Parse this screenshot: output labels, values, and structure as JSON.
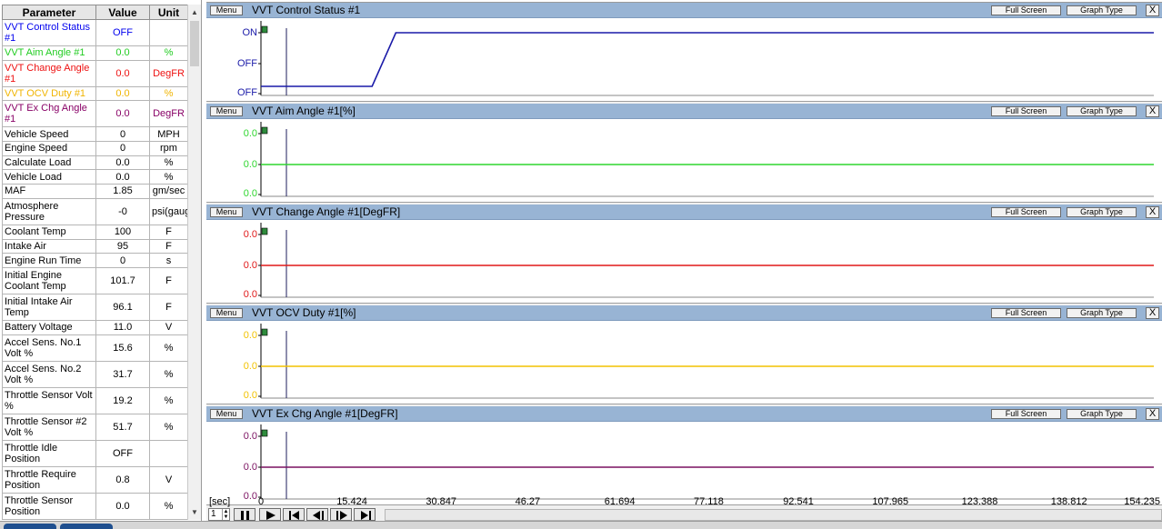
{
  "table": {
    "headers": [
      "Parameter",
      "Value",
      "Unit"
    ],
    "rows": [
      {
        "name": "VVT Control Status #1",
        "value": "OFF",
        "unit": "",
        "color": "#0000ee",
        "tall": true
      },
      {
        "name": "VVT Aim Angle #1",
        "value": "0.0",
        "unit": "%",
        "color": "#22cc22",
        "tall": false
      },
      {
        "name": "VVT Change Angle #1",
        "value": "0.0",
        "unit": "DegFR",
        "color": "#ee1111",
        "tall": true
      },
      {
        "name": "VVT OCV Duty #1",
        "value": "0.0",
        "unit": "%",
        "color": "#f0b400",
        "tall": false
      },
      {
        "name": "VVT Ex Chg Angle #1",
        "value": "0.0",
        "unit": "DegFR",
        "color": "#880066",
        "tall": true
      },
      {
        "name": "Vehicle Speed",
        "value": "0",
        "unit": "MPH",
        "color": "#000000",
        "tall": false
      },
      {
        "name": "Engine Speed",
        "value": "0",
        "unit": "rpm",
        "color": "#000000",
        "tall": false
      },
      {
        "name": "Calculate Load",
        "value": "0.0",
        "unit": "%",
        "color": "#000000",
        "tall": false
      },
      {
        "name": "Vehicle Load",
        "value": "0.0",
        "unit": "%",
        "color": "#000000",
        "tall": false
      },
      {
        "name": "MAF",
        "value": "1.85",
        "unit": "gm/sec",
        "color": "#000000",
        "tall": false
      },
      {
        "name": "Atmosphere Pressure",
        "value": "-0",
        "unit": "psi(gauge)",
        "color": "#000000",
        "tall": true
      },
      {
        "name": "Coolant Temp",
        "value": "100",
        "unit": "F",
        "color": "#000000",
        "tall": false
      },
      {
        "name": "Intake Air",
        "value": "95",
        "unit": "F",
        "color": "#000000",
        "tall": false
      },
      {
        "name": "Engine Run Time",
        "value": "0",
        "unit": "s",
        "color": "#000000",
        "tall": false
      },
      {
        "name": "Initial Engine Coolant Temp",
        "value": "101.7",
        "unit": "F",
        "color": "#000000",
        "tall": true
      },
      {
        "name": "Initial Intake Air Temp",
        "value": "96.1",
        "unit": "F",
        "color": "#000000",
        "tall": true
      },
      {
        "name": "Battery Voltage",
        "value": "11.0",
        "unit": "V",
        "color": "#000000",
        "tall": false
      },
      {
        "name": "Accel Sens. No.1 Volt %",
        "value": "15.6",
        "unit": "%",
        "color": "#000000",
        "tall": true
      },
      {
        "name": "Accel Sens. No.2 Volt %",
        "value": "31.7",
        "unit": "%",
        "color": "#000000",
        "tall": true
      },
      {
        "name": "Throttle Sensor Volt %",
        "value": "19.2",
        "unit": "%",
        "color": "#000000",
        "tall": true
      },
      {
        "name": "Throttle Sensor #2 Volt %",
        "value": "51.7",
        "unit": "%",
        "color": "#000000",
        "tall": true
      },
      {
        "name": "Throttle Idle Position",
        "value": "OFF",
        "unit": "",
        "color": "#000000",
        "tall": true
      },
      {
        "name": "Throttle Require Position",
        "value": "0.8",
        "unit": "V",
        "color": "#000000",
        "tall": true
      },
      {
        "name": "Throttle Sensor Position",
        "value": "0.0",
        "unit": "%",
        "color": "#000000",
        "tall": true
      }
    ]
  },
  "graph_buttons": {
    "menu": "Menu",
    "full_screen": "Full Screen",
    "graph_type": "Graph Type",
    "close": "X"
  },
  "graphs": [
    {
      "title": "VVT Control Status #1",
      "y_labels": [
        "ON",
        "OFF",
        "OFF"
      ],
      "color": "#1a1aa8",
      "kind": "step"
    },
    {
      "title": "VVT Aim Angle #1[%]",
      "y_labels": [
        "0.0",
        "0.0",
        "0.0"
      ],
      "color": "#2fd62f",
      "kind": "flat"
    },
    {
      "title": "VVT Change Angle #1[DegFR]",
      "y_labels": [
        "0.0",
        "0.0",
        "0.0"
      ],
      "color": "#e01818",
      "kind": "flat"
    },
    {
      "title": "VVT OCV Duty #1[%]",
      "y_labels": [
        "0.0",
        "0.0",
        "0.0"
      ],
      "color": "#f2c200",
      "kind": "flat"
    },
    {
      "title": "VVT Ex Chg Angle #1[DegFR]",
      "y_labels": [
        "0.0",
        "0.0",
        "0.0"
      ],
      "color": "#7a1060",
      "kind": "flat"
    }
  ],
  "chart_data": {
    "type": "line",
    "x_unit": "[sec]",
    "x_ticks": [
      "0",
      "15.424",
      "30.847",
      "46.27",
      "61.694",
      "77.118",
      "92.541",
      "107.965",
      "123.388",
      "138.812",
      "154.235"
    ],
    "x_range": [
      0,
      154.235
    ],
    "cursor_x": 4.4,
    "series": [
      {
        "name": "VVT Control Status #1",
        "x": [
          0,
          19.2,
          23.3,
          154.235
        ],
        "y": [
          "OFF",
          "OFF",
          "ON",
          "ON"
        ]
      },
      {
        "name": "VVT Aim Angle #1[%]",
        "x": [
          0,
          154.235
        ],
        "y": [
          0.0,
          0.0
        ]
      },
      {
        "name": "VVT Change Angle #1[DegFR]",
        "x": [
          0,
          154.235
        ],
        "y": [
          0.0,
          0.0
        ]
      },
      {
        "name": "VVT OCV Duty #1[%]",
        "x": [
          0,
          154.235
        ],
        "y": [
          0.0,
          0.0
        ]
      },
      {
        "name": "VVT Ex Chg Angle #1[DegFR]",
        "x": [
          0,
          154.235
        ],
        "y": [
          0.0,
          0.0
        ]
      }
    ]
  },
  "playback": {
    "spin_value": "1"
  }
}
